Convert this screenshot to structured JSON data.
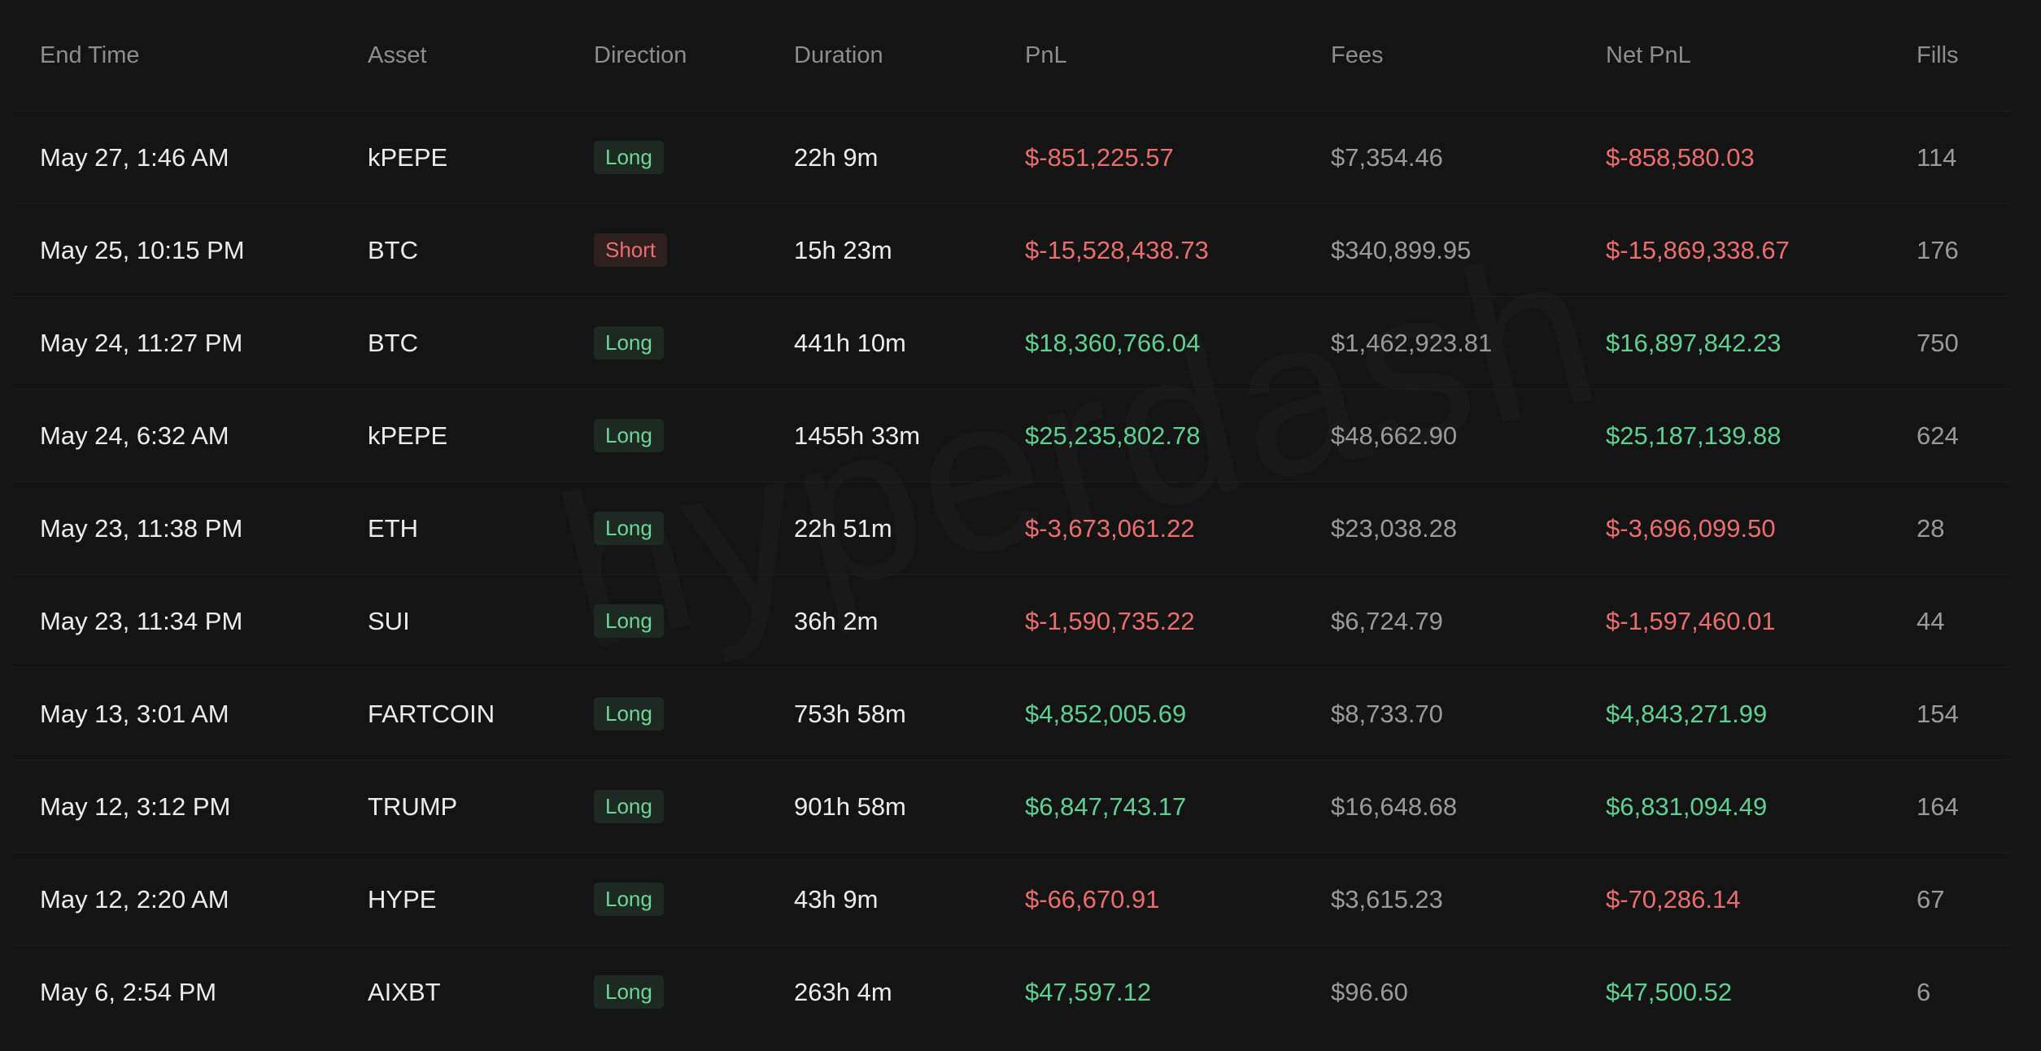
{
  "watermark": "hyperdash",
  "columns": {
    "end_time": "End Time",
    "asset": "Asset",
    "direction": "Direction",
    "duration": "Duration",
    "pnl": "PnL",
    "fees": "Fees",
    "net_pnl": "Net PnL",
    "fills": "Fills"
  },
  "colors": {
    "background": "#141414",
    "positive": "#5fcf92",
    "negative": "#ea6e6e",
    "long_badge_bg": "#1d2a22",
    "short_badge_bg": "#2f1f1f"
  },
  "rows": [
    {
      "end_time": "May 27, 1:46 AM",
      "asset": "kPEPE",
      "direction": "Long",
      "duration": "22h 9m",
      "pnl": "$-851,225.57",
      "fees": "$7,354.46",
      "net_pnl": "$-858,580.03",
      "fills": "114"
    },
    {
      "end_time": "May 25, 10:15 PM",
      "asset": "BTC",
      "direction": "Short",
      "duration": "15h 23m",
      "pnl": "$-15,528,438.73",
      "fees": "$340,899.95",
      "net_pnl": "$-15,869,338.67",
      "fills": "176"
    },
    {
      "end_time": "May 24, 11:27 PM",
      "asset": "BTC",
      "direction": "Long",
      "duration": "441h 10m",
      "pnl": "$18,360,766.04",
      "fees": "$1,462,923.81",
      "net_pnl": "$16,897,842.23",
      "fills": "750"
    },
    {
      "end_time": "May 24, 6:32 AM",
      "asset": "kPEPE",
      "direction": "Long",
      "duration": "1455h 33m",
      "pnl": "$25,235,802.78",
      "fees": "$48,662.90",
      "net_pnl": "$25,187,139.88",
      "fills": "624"
    },
    {
      "end_time": "May 23, 11:38 PM",
      "asset": "ETH",
      "direction": "Long",
      "duration": "22h 51m",
      "pnl": "$-3,673,061.22",
      "fees": "$23,038.28",
      "net_pnl": "$-3,696,099.50",
      "fills": "28"
    },
    {
      "end_time": "May 23, 11:34 PM",
      "asset": "SUI",
      "direction": "Long",
      "duration": "36h 2m",
      "pnl": "$-1,590,735.22",
      "fees": "$6,724.79",
      "net_pnl": "$-1,597,460.01",
      "fills": "44"
    },
    {
      "end_time": "May 13, 3:01 AM",
      "asset": "FARTCOIN",
      "direction": "Long",
      "duration": "753h 58m",
      "pnl": "$4,852,005.69",
      "fees": "$8,733.70",
      "net_pnl": "$4,843,271.99",
      "fills": "154"
    },
    {
      "end_time": "May 12, 3:12 PM",
      "asset": "TRUMP",
      "direction": "Long",
      "duration": "901h 58m",
      "pnl": "$6,847,743.17",
      "fees": "$16,648.68",
      "net_pnl": "$6,831,094.49",
      "fills": "164"
    },
    {
      "end_time": "May 12, 2:20 AM",
      "asset": "HYPE",
      "direction": "Long",
      "duration": "43h 9m",
      "pnl": "$-66,670.91",
      "fees": "$3,615.23",
      "net_pnl": "$-70,286.14",
      "fills": "67"
    },
    {
      "end_time": "May 6, 2:54 PM",
      "asset": "AIXBT",
      "direction": "Long",
      "duration": "263h 4m",
      "pnl": "$47,597.12",
      "fees": "$96.60",
      "net_pnl": "$47,500.52",
      "fills": "6"
    }
  ]
}
